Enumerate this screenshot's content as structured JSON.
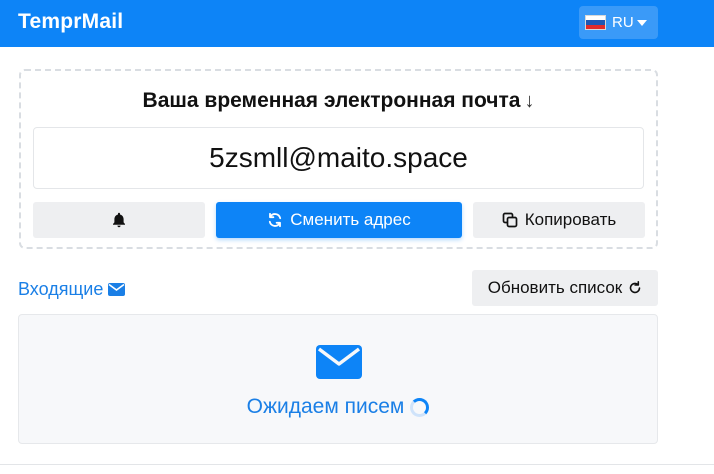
{
  "header": {
    "brand": "TemprMail",
    "language": "RU",
    "flag_colors": [
      "#ffffff",
      "#1c57b5",
      "#e02a2a"
    ],
    "bg_color": "#0d84f7"
  },
  "email_card": {
    "title": "Ваша временная электронная почта",
    "title_icon": "arrow-down-icon",
    "address": "5zsmll@maito.space",
    "buttons": {
      "notify_icon": "bell-icon",
      "change_label": "Сменить адрес",
      "change_icon": "refresh-arrows-icon",
      "copy_label": "Копировать",
      "copy_icon": "copy-icon"
    }
  },
  "inbox": {
    "label": "Входящие",
    "label_icon": "envelope-icon",
    "refresh_label": "Обновить список",
    "refresh_icon": "reload-icon",
    "waiting_text": "Ожидаем писем",
    "waiting_icon": "spinner-icon",
    "accent_color": "#1a7fe6"
  }
}
